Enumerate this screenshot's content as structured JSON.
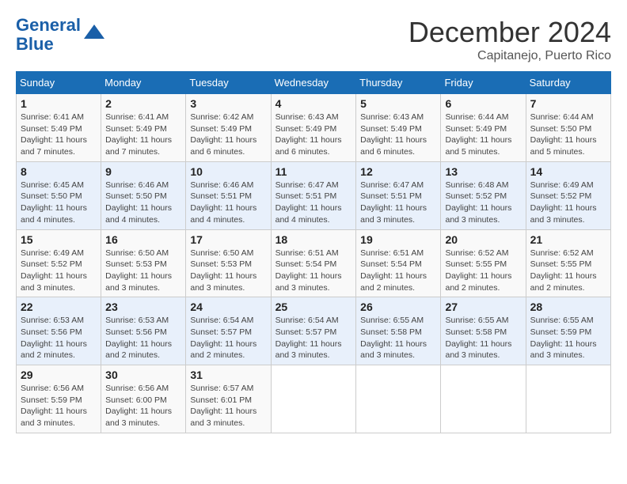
{
  "header": {
    "logo_line1": "General",
    "logo_line2": "Blue",
    "month": "December 2024",
    "location": "Capitanejo, Puerto Rico"
  },
  "columns": [
    "Sunday",
    "Monday",
    "Tuesday",
    "Wednesday",
    "Thursday",
    "Friday",
    "Saturday"
  ],
  "weeks": [
    [
      {
        "day": "1",
        "sunrise": "6:41 AM",
        "sunset": "5:49 PM",
        "daylight": "11 hours and 7 minutes."
      },
      {
        "day": "2",
        "sunrise": "6:41 AM",
        "sunset": "5:49 PM",
        "daylight": "11 hours and 7 minutes."
      },
      {
        "day": "3",
        "sunrise": "6:42 AM",
        "sunset": "5:49 PM",
        "daylight": "11 hours and 6 minutes."
      },
      {
        "day": "4",
        "sunrise": "6:43 AM",
        "sunset": "5:49 PM",
        "daylight": "11 hours and 6 minutes."
      },
      {
        "day": "5",
        "sunrise": "6:43 AM",
        "sunset": "5:49 PM",
        "daylight": "11 hours and 6 minutes."
      },
      {
        "day": "6",
        "sunrise": "6:44 AM",
        "sunset": "5:49 PM",
        "daylight": "11 hours and 5 minutes."
      },
      {
        "day": "7",
        "sunrise": "6:44 AM",
        "sunset": "5:50 PM",
        "daylight": "11 hours and 5 minutes."
      }
    ],
    [
      {
        "day": "8",
        "sunrise": "6:45 AM",
        "sunset": "5:50 PM",
        "daylight": "11 hours and 4 minutes."
      },
      {
        "day": "9",
        "sunrise": "6:46 AM",
        "sunset": "5:50 PM",
        "daylight": "11 hours and 4 minutes."
      },
      {
        "day": "10",
        "sunrise": "6:46 AM",
        "sunset": "5:51 PM",
        "daylight": "11 hours and 4 minutes."
      },
      {
        "day": "11",
        "sunrise": "6:47 AM",
        "sunset": "5:51 PM",
        "daylight": "11 hours and 4 minutes."
      },
      {
        "day": "12",
        "sunrise": "6:47 AM",
        "sunset": "5:51 PM",
        "daylight": "11 hours and 3 minutes."
      },
      {
        "day": "13",
        "sunrise": "6:48 AM",
        "sunset": "5:52 PM",
        "daylight": "11 hours and 3 minutes."
      },
      {
        "day": "14",
        "sunrise": "6:49 AM",
        "sunset": "5:52 PM",
        "daylight": "11 hours and 3 minutes."
      }
    ],
    [
      {
        "day": "15",
        "sunrise": "6:49 AM",
        "sunset": "5:52 PM",
        "daylight": "11 hours and 3 minutes."
      },
      {
        "day": "16",
        "sunrise": "6:50 AM",
        "sunset": "5:53 PM",
        "daylight": "11 hours and 3 minutes."
      },
      {
        "day": "17",
        "sunrise": "6:50 AM",
        "sunset": "5:53 PM",
        "daylight": "11 hours and 3 minutes."
      },
      {
        "day": "18",
        "sunrise": "6:51 AM",
        "sunset": "5:54 PM",
        "daylight": "11 hours and 3 minutes."
      },
      {
        "day": "19",
        "sunrise": "6:51 AM",
        "sunset": "5:54 PM",
        "daylight": "11 hours and 2 minutes."
      },
      {
        "day": "20",
        "sunrise": "6:52 AM",
        "sunset": "5:55 PM",
        "daylight": "11 hours and 2 minutes."
      },
      {
        "day": "21",
        "sunrise": "6:52 AM",
        "sunset": "5:55 PM",
        "daylight": "11 hours and 2 minutes."
      }
    ],
    [
      {
        "day": "22",
        "sunrise": "6:53 AM",
        "sunset": "5:56 PM",
        "daylight": "11 hours and 2 minutes."
      },
      {
        "day": "23",
        "sunrise": "6:53 AM",
        "sunset": "5:56 PM",
        "daylight": "11 hours and 2 minutes."
      },
      {
        "day": "24",
        "sunrise": "6:54 AM",
        "sunset": "5:57 PM",
        "daylight": "11 hours and 2 minutes."
      },
      {
        "day": "25",
        "sunrise": "6:54 AM",
        "sunset": "5:57 PM",
        "daylight": "11 hours and 3 minutes."
      },
      {
        "day": "26",
        "sunrise": "6:55 AM",
        "sunset": "5:58 PM",
        "daylight": "11 hours and 3 minutes."
      },
      {
        "day": "27",
        "sunrise": "6:55 AM",
        "sunset": "5:58 PM",
        "daylight": "11 hours and 3 minutes."
      },
      {
        "day": "28",
        "sunrise": "6:55 AM",
        "sunset": "5:59 PM",
        "daylight": "11 hours and 3 minutes."
      }
    ],
    [
      {
        "day": "29",
        "sunrise": "6:56 AM",
        "sunset": "5:59 PM",
        "daylight": "11 hours and 3 minutes."
      },
      {
        "day": "30",
        "sunrise": "6:56 AM",
        "sunset": "6:00 PM",
        "daylight": "11 hours and 3 minutes."
      },
      {
        "day": "31",
        "sunrise": "6:57 AM",
        "sunset": "6:01 PM",
        "daylight": "11 hours and 3 minutes."
      },
      null,
      null,
      null,
      null
    ]
  ]
}
